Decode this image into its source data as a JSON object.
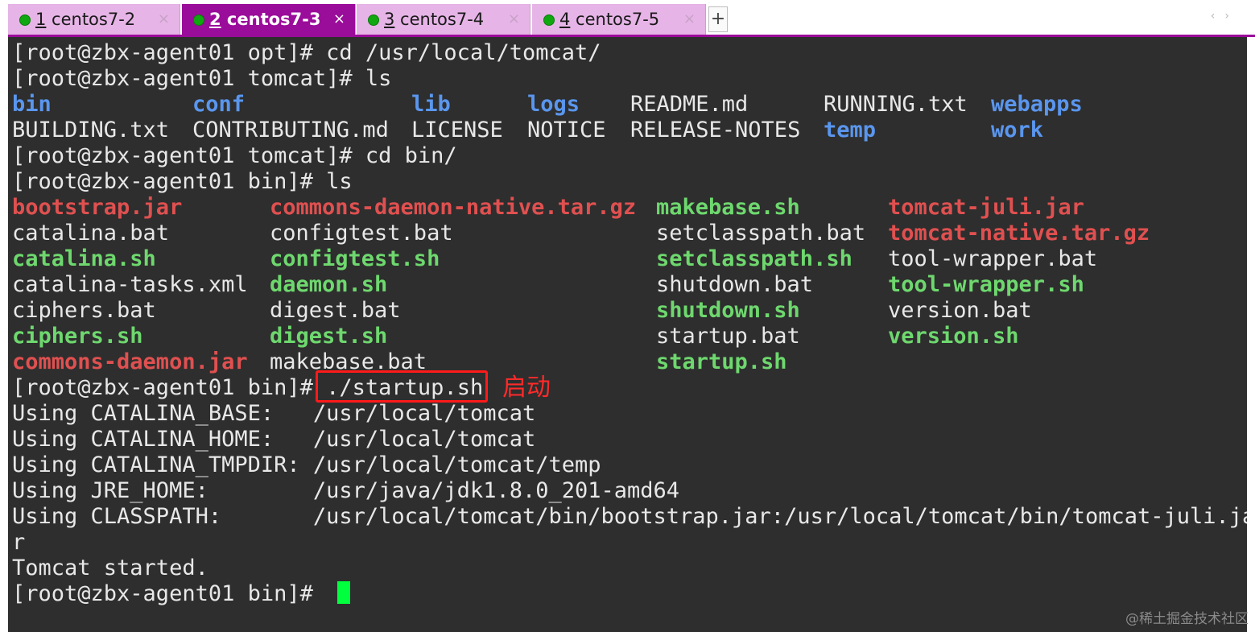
{
  "tabs": [
    {
      "num": "1",
      "name": " centos7-2",
      "active": false
    },
    {
      "num": "2",
      "name": " centos7-3",
      "active": true
    },
    {
      "num": "3",
      "name": " centos7-4",
      "active": false
    },
    {
      "num": "4",
      "name": " centos7-5",
      "active": false
    }
  ],
  "tab_close_glyph": "×",
  "new_tab_glyph": "+",
  "scroll_arrows": "‹›",
  "terminal": {
    "l01": "[root@zbx-agent01 opt]# cd /usr/local/tomcat/",
    "l02": "[root@zbx-agent01 tomcat]# ls",
    "ls1": {
      "row1": [
        "bin",
        "conf",
        "lib",
        "logs",
        "README.md",
        "RUNNING.txt",
        "webapps"
      ],
      "row2": [
        "BUILDING.txt",
        "CONTRIBUTING.md",
        "LICENSE",
        "NOTICE",
        "RELEASE-NOTES",
        "temp",
        "work"
      ]
    },
    "l05": "[root@zbx-agent01 tomcat]# cd bin/",
    "l06": "[root@zbx-agent01 bin]# ls",
    "ls2": [
      [
        "bootstrap.jar",
        "commons-daemon-native.tar.gz",
        "makebase.sh",
        "tomcat-juli.jar"
      ],
      [
        "catalina.bat",
        "configtest.bat",
        "setclasspath.bat",
        "tomcat-native.tar.gz"
      ],
      [
        "catalina.sh",
        "configtest.sh",
        "setclasspath.sh",
        "tool-wrapper.bat"
      ],
      [
        "catalina-tasks.xml",
        "daemon.sh",
        "shutdown.bat",
        "tool-wrapper.sh"
      ],
      [
        "ciphers.bat",
        "digest.bat",
        "shutdown.sh",
        "version.bat"
      ],
      [
        "ciphers.sh",
        "digest.sh",
        "startup.bat",
        "version.sh"
      ],
      [
        "commons-daemon.jar",
        "makebase.bat",
        "startup.sh",
        ""
      ]
    ],
    "l14_prompt": "[root@zbx-agent01 bin]# ",
    "l14_cmd": "./startup.sh",
    "l15": "Using CATALINA_BASE:   /usr/local/tomcat",
    "l16": "Using CATALINA_HOME:   /usr/local/tomcat",
    "l17": "Using CATALINA_TMPDIR: /usr/local/tomcat/temp",
    "l18": "Using JRE_HOME:        /usr/java/jdk1.8.0_201-amd64",
    "l19": "Using CLASSPATH:       /usr/local/tomcat/bin/bootstrap.jar:/usr/local/tomcat/bin/tomcat-juli.ja",
    "l20": "r",
    "l21": "Tomcat started.",
    "l22": "[root@zbx-agent01 bin]# "
  },
  "annotation": "启动",
  "watermark": "@稀土掘金技术社区",
  "colors": {
    "directory": "#5a96ee",
    "executable": "#6ed86e",
    "archive": "#e05050",
    "cursor": "#00ff3c",
    "active_tab": "#9a0c9a",
    "inactive_tab": "#e6b4e6",
    "highlight_box": "#ff1a1a"
  }
}
